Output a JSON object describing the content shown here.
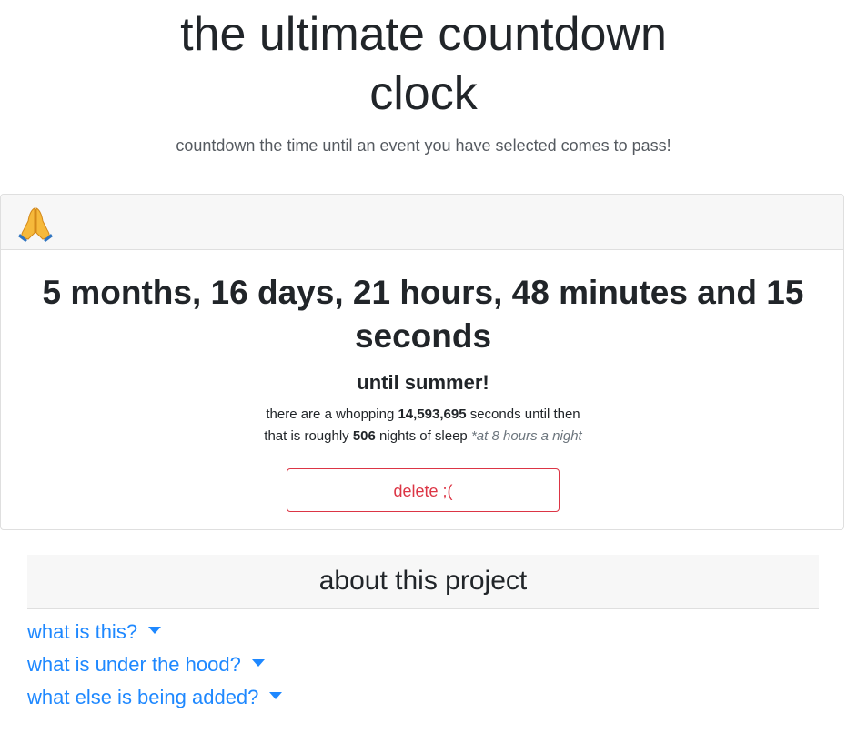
{
  "header": {
    "title": "the ultimate countdown clock",
    "subtitle": "countdown the time until an event you have selected comes to pass!"
  },
  "countdown_card": {
    "icon": "folded-hands-icon",
    "countdown_text": "5 months, 16 days, 21 hours, 48 minutes and 15 seconds",
    "event_text": "until summer!",
    "seconds_prefix": "there are a whopping",
    "seconds_value": "14,593,695",
    "seconds_suffix": "seconds until then",
    "sleep_prefix": "that is roughly",
    "sleep_value": "506",
    "sleep_suffix": "nights of sleep",
    "sleep_note": "*at 8 hours a night",
    "delete_label": "delete ;("
  },
  "about": {
    "heading": "about this project",
    "items": [
      {
        "label": "what is this?"
      },
      {
        "label": "what is under the hood?"
      },
      {
        "label": "what else is being added?"
      }
    ]
  },
  "colors": {
    "accent_link": "#1e88ff",
    "danger": "#dc3545",
    "header_bg": "#f7f7f7",
    "text": "#212529"
  }
}
